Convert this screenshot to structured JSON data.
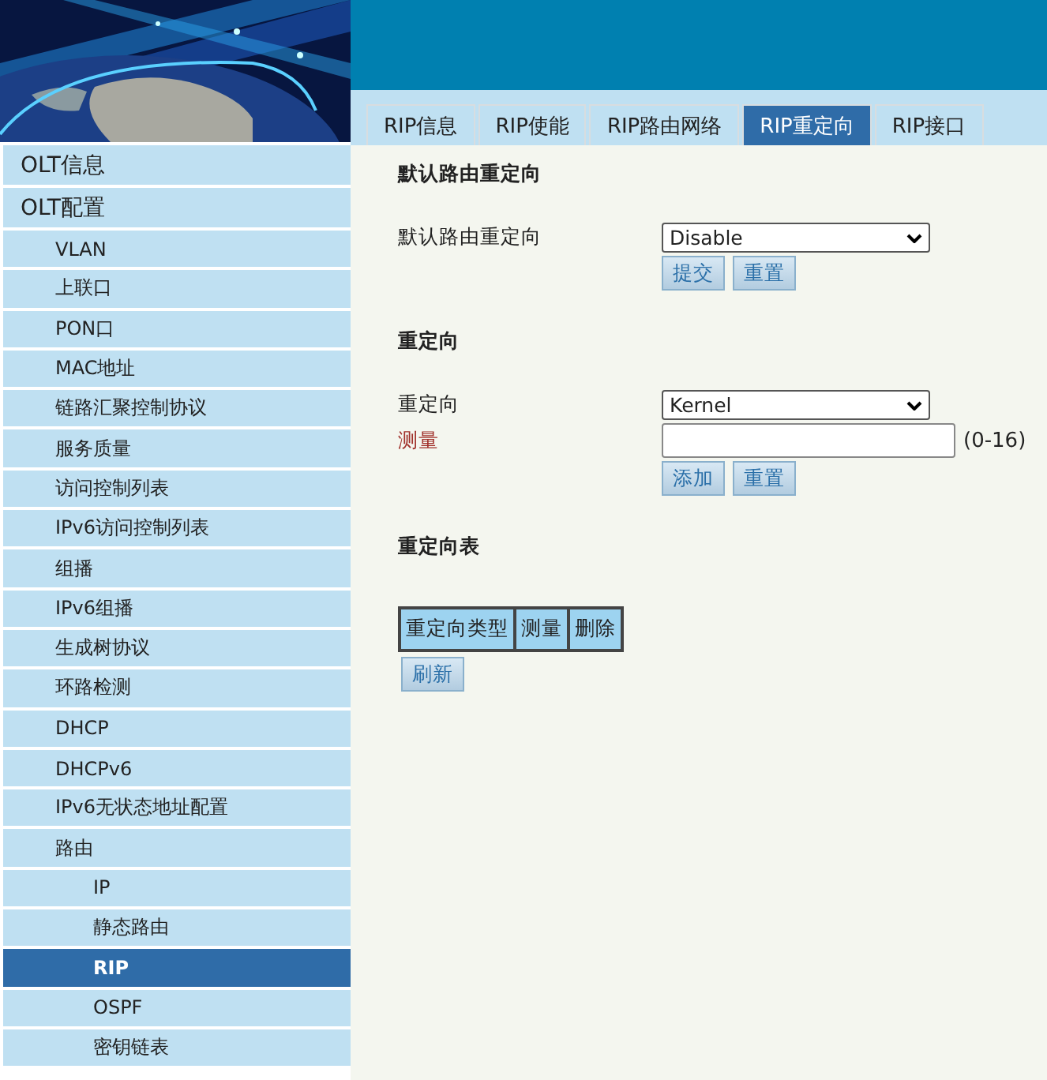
{
  "tabs": [
    {
      "label": "RIP信息",
      "selected": false
    },
    {
      "label": "RIP使能",
      "selected": false
    },
    {
      "label": "RIP路由网络",
      "selected": false
    },
    {
      "label": "RIP重定向",
      "selected": true
    },
    {
      "label": "RIP接口",
      "selected": false
    }
  ],
  "sidebar": {
    "items": [
      {
        "label": "OLT信息",
        "selected": false
      },
      {
        "label": "OLT配置",
        "selected": false,
        "children": [
          {
            "label": "VLAN",
            "selected": false
          },
          {
            "label": "上联口",
            "selected": false
          },
          {
            "label": "PON口",
            "selected": false
          },
          {
            "label": "MAC地址",
            "selected": false
          },
          {
            "label": "链路汇聚控制协议",
            "selected": false
          },
          {
            "label": "服务质量",
            "selected": false
          },
          {
            "label": "访问控制列表",
            "selected": false
          },
          {
            "label": "IPv6访问控制列表",
            "selected": false
          },
          {
            "label": "组播",
            "selected": false
          },
          {
            "label": "IPv6组播",
            "selected": false
          },
          {
            "label": "生成树协议",
            "selected": false
          },
          {
            "label": "环路检测",
            "selected": false
          },
          {
            "label": "DHCP",
            "selected": false
          },
          {
            "label": "DHCPv6",
            "selected": false
          },
          {
            "label": "IPv6无状态地址配置",
            "selected": false
          },
          {
            "label": "路由",
            "selected": false,
            "children": [
              {
                "label": "IP",
                "selected": false
              },
              {
                "label": "静态路由",
                "selected": false
              },
              {
                "label": "RIP",
                "selected": true
              },
              {
                "label": "OSPF",
                "selected": false
              },
              {
                "label": "密钥链表",
                "selected": false
              }
            ]
          }
        ]
      }
    ]
  },
  "sections": [
    {
      "title": "默认路由重定向",
      "fields": [
        {
          "kind": "select",
          "label": "默认路由重定向",
          "required": false,
          "value": "Disable"
        }
      ],
      "buttons": [
        "提交",
        "重置"
      ]
    },
    {
      "title": "重定向",
      "fields": [
        {
          "kind": "select",
          "label": "重定向",
          "required": false,
          "value": "Kernel"
        },
        {
          "kind": "input",
          "label": "测量",
          "required": true,
          "hint": "(0-16)"
        }
      ],
      "buttons": [
        "添加",
        "重置"
      ]
    },
    {
      "title": "重定向表",
      "table": {
        "columns": [
          "重定向类型",
          "测量",
          "删除"
        ]
      },
      "buttons": [
        "刷新"
      ]
    }
  ]
}
